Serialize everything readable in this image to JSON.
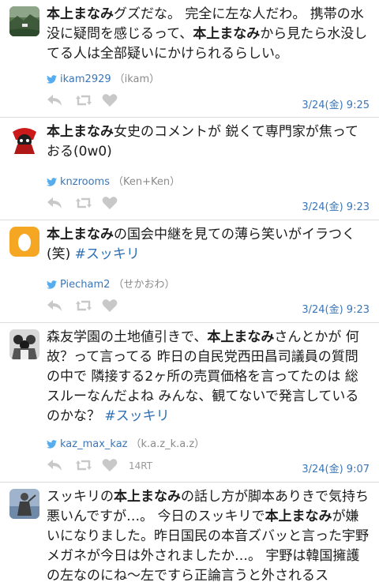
{
  "tweets": [
    {
      "segments": [
        {
          "t": "本上まなみ",
          "s": "b"
        },
        {
          "t": "グズだな。 完全に左な人だわ。 携帯の水没に疑問を感じるって、",
          "s": ""
        },
        {
          "t": "本上まなみ",
          "s": "b"
        },
        {
          "t": "から見たら水没してる人は全部疑いにかけられるらしい。",
          "s": ""
        }
      ],
      "handle": "ikam2929",
      "name": "（ikam）",
      "retweet_count": "",
      "timestamp": "3/24(金) 9:25",
      "avatar": "landscape-avatar"
    },
    {
      "segments": [
        {
          "t": "本上まなみ",
          "s": "b"
        },
        {
          "t": "女史のコメントが 鋭くて専門家が焦っておる(0w0)",
          "s": ""
        }
      ],
      "handle": "knzrooms",
      "name": "（Ken+Ken）",
      "retweet_count": "",
      "timestamp": "3/24(金) 9:23",
      "avatar": "character-avatar"
    },
    {
      "segments": [
        {
          "t": "本上まなみ",
          "s": "b"
        },
        {
          "t": "の国会中継を見ての薄ら笑いがイラつく(笑) ",
          "s": ""
        },
        {
          "t": "#スッキリ",
          "s": "h"
        }
      ],
      "handle": "Piecham2",
      "name": "（せかおわ）",
      "retweet_count": "",
      "timestamp": "3/24(金) 9:23",
      "avatar": "egg-avatar"
    },
    {
      "segments": [
        {
          "t": "森友学園の土地値引きで、",
          "s": ""
        },
        {
          "t": "本上まなみ",
          "s": "b"
        },
        {
          "t": "さんとかが 何故？って言ってる 昨日の自民党西田昌司議員の質問の中で 隣接する2ヶ所の売買価格を言ってたのは 総スルーなんだよね みんな、観てないで発言しているのかな？ ",
          "s": ""
        },
        {
          "t": "#スッキリ",
          "s": "h"
        }
      ],
      "handle": "kaz_max_kaz",
      "name": "（k.a.z_k.a.z）",
      "retweet_count": "14RT",
      "timestamp": "3/24(金) 9:07",
      "avatar": "group-avatar"
    },
    {
      "segments": [
        {
          "t": "スッキリの",
          "s": ""
        },
        {
          "t": "本上まなみ",
          "s": "b"
        },
        {
          "t": "の話し方が脚本ありきで気持ち悪いんですが…。 今日のスッキリで",
          "s": ""
        },
        {
          "t": "本上まなみ",
          "s": "b"
        },
        {
          "t": "が嫌いになりました。昨日国民の本音ズバッと言った宇野メガネが今日は外されましたか…。 宇野は韓国擁護の左なのにね〜左ですら正論言うと外されるス",
          "s": ""
        }
      ],
      "handle": "",
      "name": "",
      "retweet_count": "",
      "timestamp": "",
      "avatar": "statue-avatar"
    }
  ],
  "colors": {
    "link": "#3a76b8",
    "hashtag": "#2f6fb4",
    "icon": "#c8c8c8",
    "egg_bg": "#f5a623"
  }
}
